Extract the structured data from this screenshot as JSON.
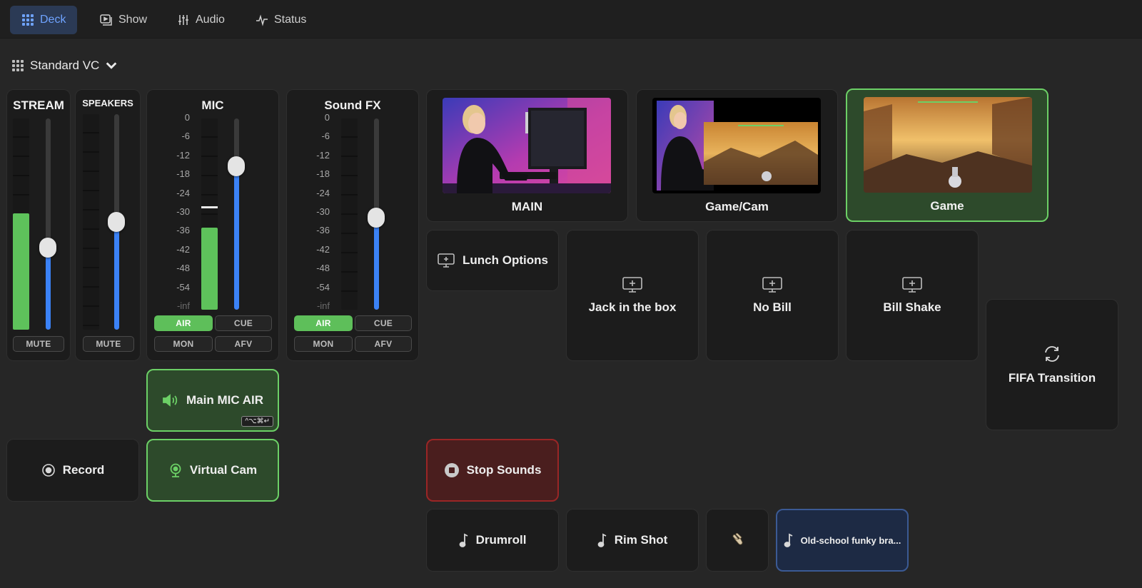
{
  "nav": {
    "tabs": [
      {
        "label": "Deck",
        "icon": "grid-icon",
        "active": true
      },
      {
        "label": "Show",
        "icon": "play-icon",
        "active": false
      },
      {
        "label": "Audio",
        "icon": "mixer-icon",
        "active": false
      },
      {
        "label": "Status",
        "icon": "pulse-icon",
        "active": false
      }
    ]
  },
  "preset": {
    "label": "Standard VC"
  },
  "scale": [
    "0",
    "-6",
    "-12",
    "-18",
    "-24",
    "-30",
    "-36",
    "-42",
    "-48",
    "-54",
    "-inf"
  ],
  "strips": {
    "stream": {
      "title": "STREAM",
      "level": 0.55,
      "fader": 0.39,
      "mute": "MUTE"
    },
    "speakers": {
      "title": "SPEAKERS",
      "level": 0,
      "fader": 0.5,
      "mute": "MUTE"
    },
    "mic": {
      "title": "MIC",
      "level": 0.43,
      "peak": 0.53,
      "fader": 0.75,
      "air": "AIR",
      "cue": "CUE",
      "mon": "MON",
      "afv": "AFV"
    },
    "soundfx": {
      "title": "Sound FX",
      "level": 0,
      "fader": 0.48,
      "air": "AIR",
      "cue": "CUE",
      "mon": "MON",
      "afv": "AFV"
    }
  },
  "scenes": [
    {
      "label": "MAIN",
      "selected": false
    },
    {
      "label": "Game/Cam",
      "selected": false
    },
    {
      "label": "Game",
      "selected": true
    }
  ],
  "buttons": {
    "lunch": "Lunch Options",
    "jack": "Jack in the box",
    "nobill": "No Bill",
    "billshake": "Bill Shake",
    "fifa": "FIFA Transition",
    "mainmic": "Main MIC AIR",
    "mainmic_shortcut": "^⌥⌘↵",
    "record": "Record",
    "virtualcam": "Virtual Cam",
    "stopsounds": "Stop Sounds",
    "drumroll": "Drumroll",
    "rimshot": "Rim Shot",
    "funky": "Old-school funky bra..."
  },
  "colors": {
    "accent": "#3b82f6",
    "active_green": "#6cd066",
    "meter_green": "#5ec25b",
    "stop_red": "#9a2626"
  }
}
